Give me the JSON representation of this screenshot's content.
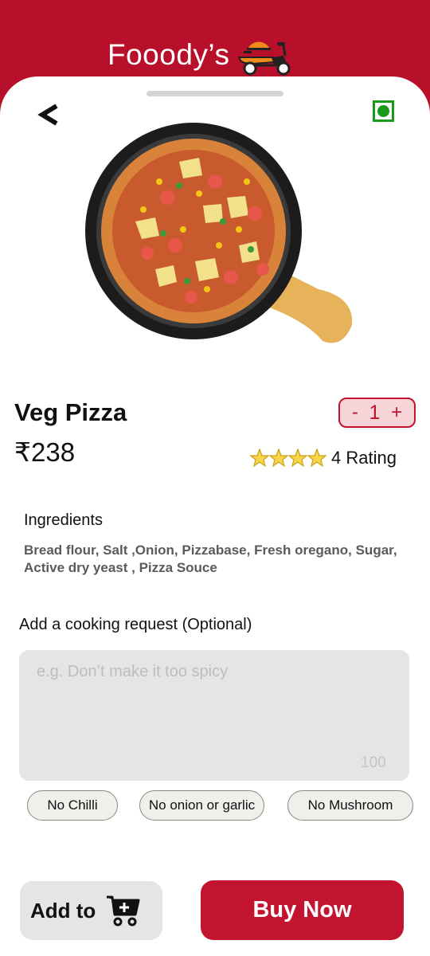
{
  "header": {
    "app_title": "Fooody’s"
  },
  "product": {
    "name": "Veg Pizza",
    "price": "₹238",
    "quantity": {
      "minus": "-",
      "value": "1",
      "plus": "+"
    },
    "rating": {
      "stars": 4,
      "text": "4 Rating"
    },
    "veg_indicator_color": "#1a9a1a"
  },
  "ingredients": {
    "title": "Ingredients",
    "list": "Bread flour, Salt ,Onion, Pizzabase, Fresh oregano, Sugar,  Active dry yeast , Pizza Souce"
  },
  "cooking_request": {
    "label": "Add a cooking request (Optional)",
    "placeholder": "e.g. Don’t make it too spicy",
    "char_limit": "100"
  },
  "chips": [
    {
      "label": "No Chilli"
    },
    {
      "label": "No onion or garlic"
    },
    {
      "label": "No Mushroom"
    }
  ],
  "actions": {
    "add_to_cart_label": "Add to",
    "buy_now_label": "Buy Now"
  },
  "colors": {
    "brand": "#b8102a",
    "accent": "#c2142e"
  }
}
